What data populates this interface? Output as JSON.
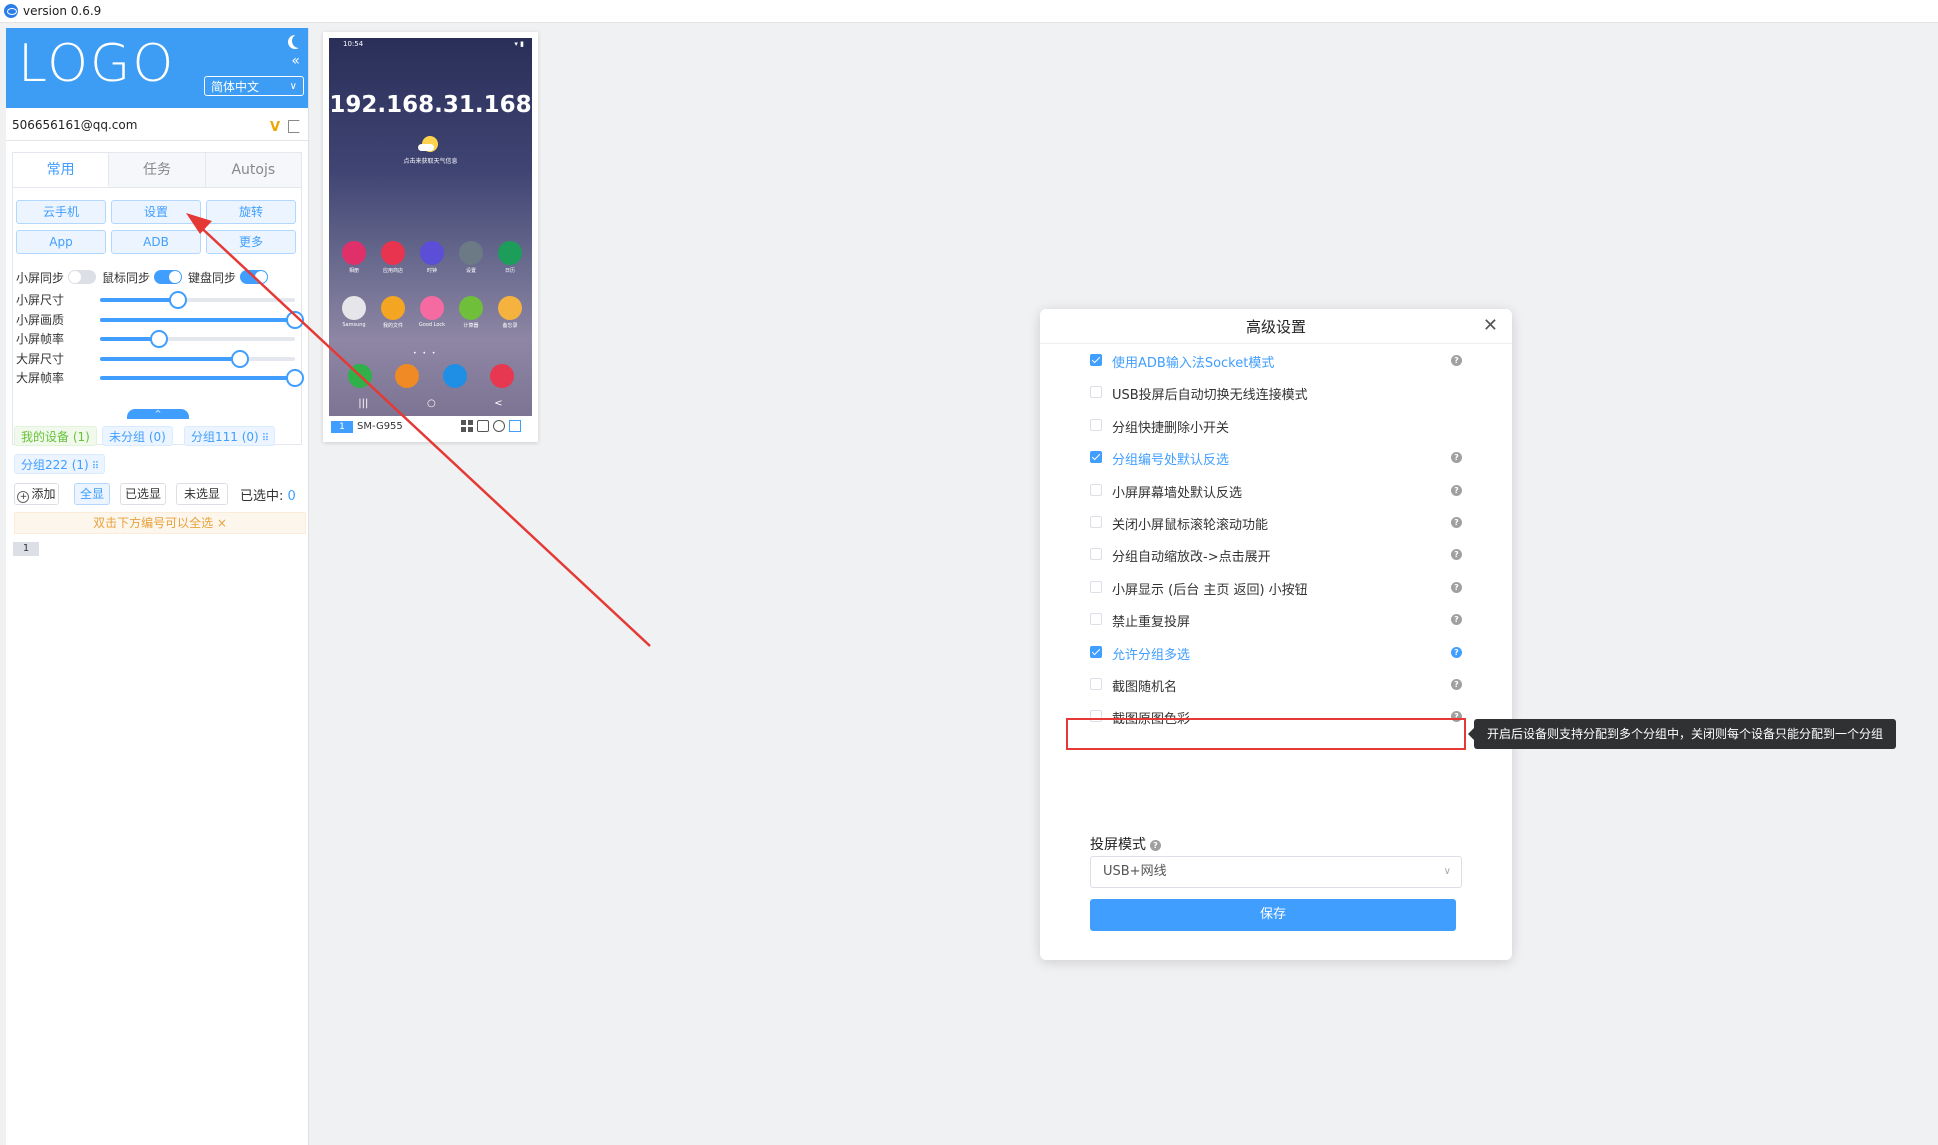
{
  "app": {
    "version": "version 0.6.9"
  },
  "sidebar": {
    "logo": "LOGO",
    "language": "简体中文",
    "email": "506656161@qq.com",
    "tabs": [
      {
        "label": "常用",
        "active": true
      },
      {
        "label": "任务",
        "active": false
      },
      {
        "label": "Autojs",
        "active": false
      }
    ],
    "buttons": [
      "云手机",
      "设置",
      "旋转",
      "App",
      "ADB",
      "更多"
    ],
    "toggles": [
      {
        "label": "小屏同步",
        "on": false
      },
      {
        "label": "鼠标同步",
        "on": true
      },
      {
        "label": "键盘同步",
        "on": true
      }
    ],
    "sliders": [
      {
        "label": "小屏尺寸",
        "value": 0.4
      },
      {
        "label": "小屏画质",
        "value": 1.0
      },
      {
        "label": "小屏帧率",
        "value": 0.3
      },
      {
        "label": "大屏尺寸",
        "value": 0.72
      },
      {
        "label": "大屏帧率",
        "value": 1.0
      }
    ],
    "groups": [
      {
        "label": "我的设备 (1)",
        "style": "green"
      },
      {
        "label": "未分组 (0)",
        "style": "blue"
      },
      {
        "label": "分组111 (0)",
        "style": "blue"
      },
      {
        "label": "分组222 (1)",
        "style": "blue"
      }
    ],
    "controls": {
      "add": "添加",
      "show_all": "全显",
      "show_selected": "已选显",
      "show_unselected": "未选显",
      "selected_label": "已选中:",
      "selected_count": "0"
    },
    "notice": "双击下方编号可以全选 ×",
    "device_index": "1"
  },
  "phone": {
    "status_time": "10:54",
    "ip": "192.168.31.168",
    "weather_text": "点击来获取天气信息",
    "apps_row1": [
      {
        "name": "相册",
        "color": "#e0306a"
      },
      {
        "name": "应用商店",
        "color": "#e8344e"
      },
      {
        "name": "时钟",
        "color": "#5a4fd6"
      },
      {
        "name": "设置",
        "color": "#6c7a86"
      },
      {
        "name": "日历",
        "color": "#1c9e5a"
      }
    ],
    "apps_row2": [
      {
        "name": "Samsung",
        "color": "#e6e6ea"
      },
      {
        "name": "我的文件",
        "color": "#f4a623"
      },
      {
        "name": "Good Lock",
        "color": "#f56aa0"
      },
      {
        "name": "计算器",
        "color": "#6fbf3a"
      },
      {
        "name": "备忘录",
        "color": "#f6b23e"
      }
    ],
    "dock": [
      {
        "color": "#2fb04a"
      },
      {
        "color": "#f08a24"
      },
      {
        "color": "#1f8fe5"
      },
      {
        "color": "#e63950"
      }
    ],
    "index": "1",
    "model": "SM-G955"
  },
  "dialog": {
    "title": "高级设置",
    "options": [
      {
        "label": "使用ADB输入法Socket模式",
        "checked": true,
        "help": true
      },
      {
        "label": "USB投屏后自动切换无线连接模式",
        "checked": false,
        "help": false
      },
      {
        "label": "分组快捷删除小开关",
        "checked": false,
        "help": false
      },
      {
        "label": "分组编号处默认反选",
        "checked": true,
        "help": true
      },
      {
        "label": "小屏屏幕墙处默认反选",
        "checked": false,
        "help": true
      },
      {
        "label": "关闭小屏鼠标滚轮滚动功能",
        "checked": false,
        "help": true
      },
      {
        "label": "分组自动缩放改->点击展开",
        "checked": false,
        "help": true
      },
      {
        "label": "小屏显示 (后台 主页 返回) 小按钮",
        "checked": false,
        "help": true
      },
      {
        "label": "禁止重复投屏",
        "checked": false,
        "help": true
      },
      {
        "label": "允许分组多选",
        "checked": true,
        "help": true,
        "highlight": true
      },
      {
        "label": "截图随机名",
        "checked": false,
        "help": true
      },
      {
        "label": "截图原图色彩",
        "checked": false,
        "help": true
      }
    ],
    "tooltip": "开启后设备则支持分配到多个分组中，关闭则每个设备只能分配到一个分组",
    "mode_label": "投屏模式",
    "mode_value": "USB+网线",
    "save": "保存"
  },
  "colors": {
    "primary": "#409eff",
    "logo_bg": "#3d9cf4",
    "annotation": "#e53935"
  }
}
